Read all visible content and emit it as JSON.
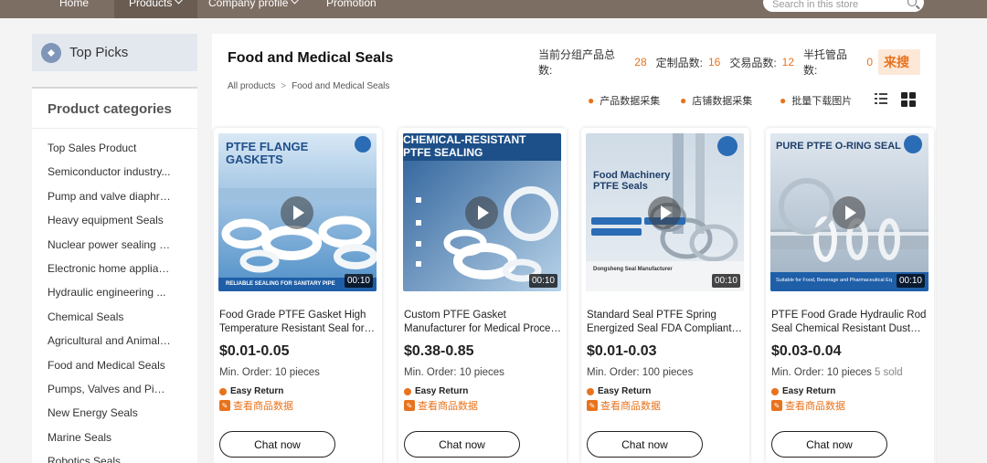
{
  "nav": {
    "items": [
      {
        "label": "Home",
        "dropdown": false
      },
      {
        "label": "Products",
        "dropdown": true
      },
      {
        "label": "Company profile",
        "dropdown": true
      },
      {
        "label": "Promotion",
        "dropdown": false
      }
    ],
    "search_placeholder": "Search in this store"
  },
  "sidebar": {
    "top_picks": "Top Picks",
    "categories_title": "Product categories",
    "categories": [
      "Top Sales Product",
      "Semiconductor industry...",
      "Pump and valve diaphra...",
      "Heavy equipment Seals",
      "Nuclear power sealing c...",
      "Electronic home applian...",
      "Hydraulic engineering ...",
      "Chemical Seals",
      "Agricultural and Animal ...",
      "Food and Medical Seals",
      "Pumps, Valves and Pipe...",
      "New Energy Seals",
      "Marine Seals",
      "Robotics Seals"
    ]
  },
  "main": {
    "title": "Food and Medical Seals",
    "breadcrumb": [
      "All products",
      "Food and Medical Seals"
    ],
    "stats": [
      {
        "label": "当前分组产品总数:",
        "value": "28"
      },
      {
        "label": "定制品数:",
        "value": "16"
      },
      {
        "label": "交易品数:",
        "value": "12"
      },
      {
        "label": "半托管品数:",
        "value": "0"
      }
    ],
    "stats_logo": "来搜",
    "actions": [
      "产品数据采集",
      "店铺数据采集",
      "批量下载图片"
    ]
  },
  "products": [
    {
      "title": "Food Grade PTFE Gasket High Temperature Resistant Seal for Food Processing",
      "price": "$0.01-0.05",
      "min_order": "Min. Order: 10 pieces",
      "sold": "",
      "easy_return": "Easy Return",
      "view_data": "查看商品数据",
      "chat": "Chat now",
      "duration": "00:10",
      "image_heading": "PTFE FLANGE GASKETS",
      "image_caption": "RELIABLE SEALING FOR SANITARY PIPE"
    },
    {
      "title": "Custom PTFE Gasket Manufacturer for Medical Process Fluids",
      "price": "$0.38-0.85",
      "min_order": "Min. Order: 10 pieces",
      "sold": "",
      "easy_return": "Easy Return",
      "view_data": "查看商品数据",
      "chat": "Chat now",
      "duration": "00:10",
      "image_heading": "CHEMICAL-RESISTANT PTFE SEALING",
      "image_caption": ""
    },
    {
      "title": "Standard Seal PTFE Spring Energized Seal FDA Compliant Food Machinery",
      "price": "$0.01-0.03",
      "min_order": "Min. Order: 100 pieces",
      "sold": "",
      "easy_return": "Easy Return",
      "view_data": "查看商品数据",
      "chat": "Chat now",
      "duration": "00:10",
      "image_heading": "Food Machinery PTFE Seals",
      "image_caption": "Dongsheng Seal Manufacturer"
    },
    {
      "title": "PTFE Food Grade Hydraulic Rod Seal Chemical Resistant Dust Seal",
      "price": "$0.03-0.04",
      "min_order": "Min. Order: 10 pieces",
      "sold": "5 sold",
      "easy_return": "Easy Return",
      "view_data": "查看商品数据",
      "chat": "Chat now",
      "duration": "00:10",
      "image_heading": "PURE PTFE O-RING SEAL",
      "image_caption": "Suitable for Food, Beverage and Pharmaceutical Eq"
    }
  ],
  "colors": {
    "nav_bg": "#7d6e63",
    "accent_orange": "#e8731d",
    "top_picks_bg": "#e3e8ef",
    "image_blue": "#1f5fa8"
  }
}
